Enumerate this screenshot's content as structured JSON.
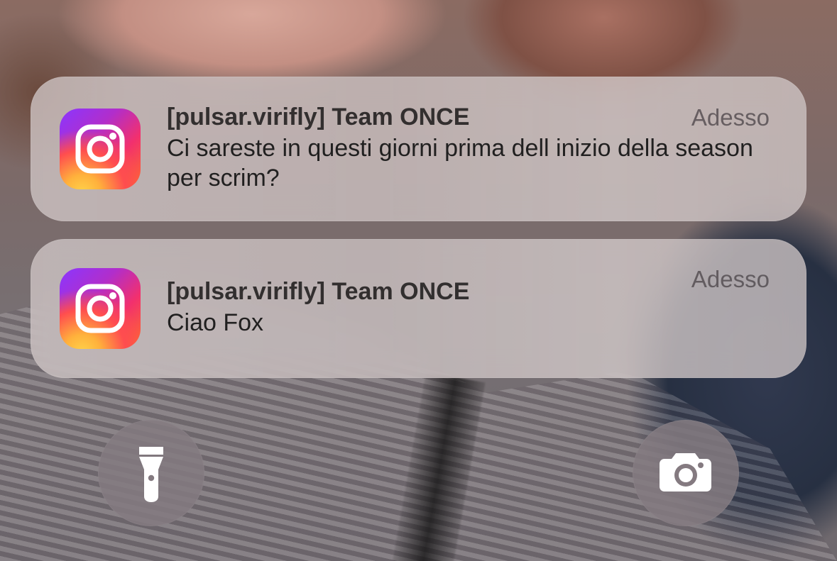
{
  "notifications": [
    {
      "app_icon": "instagram-icon",
      "title": "[pulsar.virifly] Team ONCE",
      "message": "Ci sareste in questi giorni prima dell inizio della season per scrim?",
      "time": "Adesso"
    },
    {
      "app_icon": "instagram-icon",
      "title": "[pulsar.virifly] Team ONCE",
      "message": "Ciao Fox",
      "time": "Adesso"
    }
  ],
  "quick_actions": {
    "flashlight_icon": "flashlight-icon",
    "camera_icon": "camera-icon"
  },
  "colors": {
    "instagram_gradient": [
      "#8a36ff",
      "#f2306d",
      "#ffb13c"
    ],
    "notification_background": "#cdc3c2",
    "quick_action_background": "#847a80"
  }
}
